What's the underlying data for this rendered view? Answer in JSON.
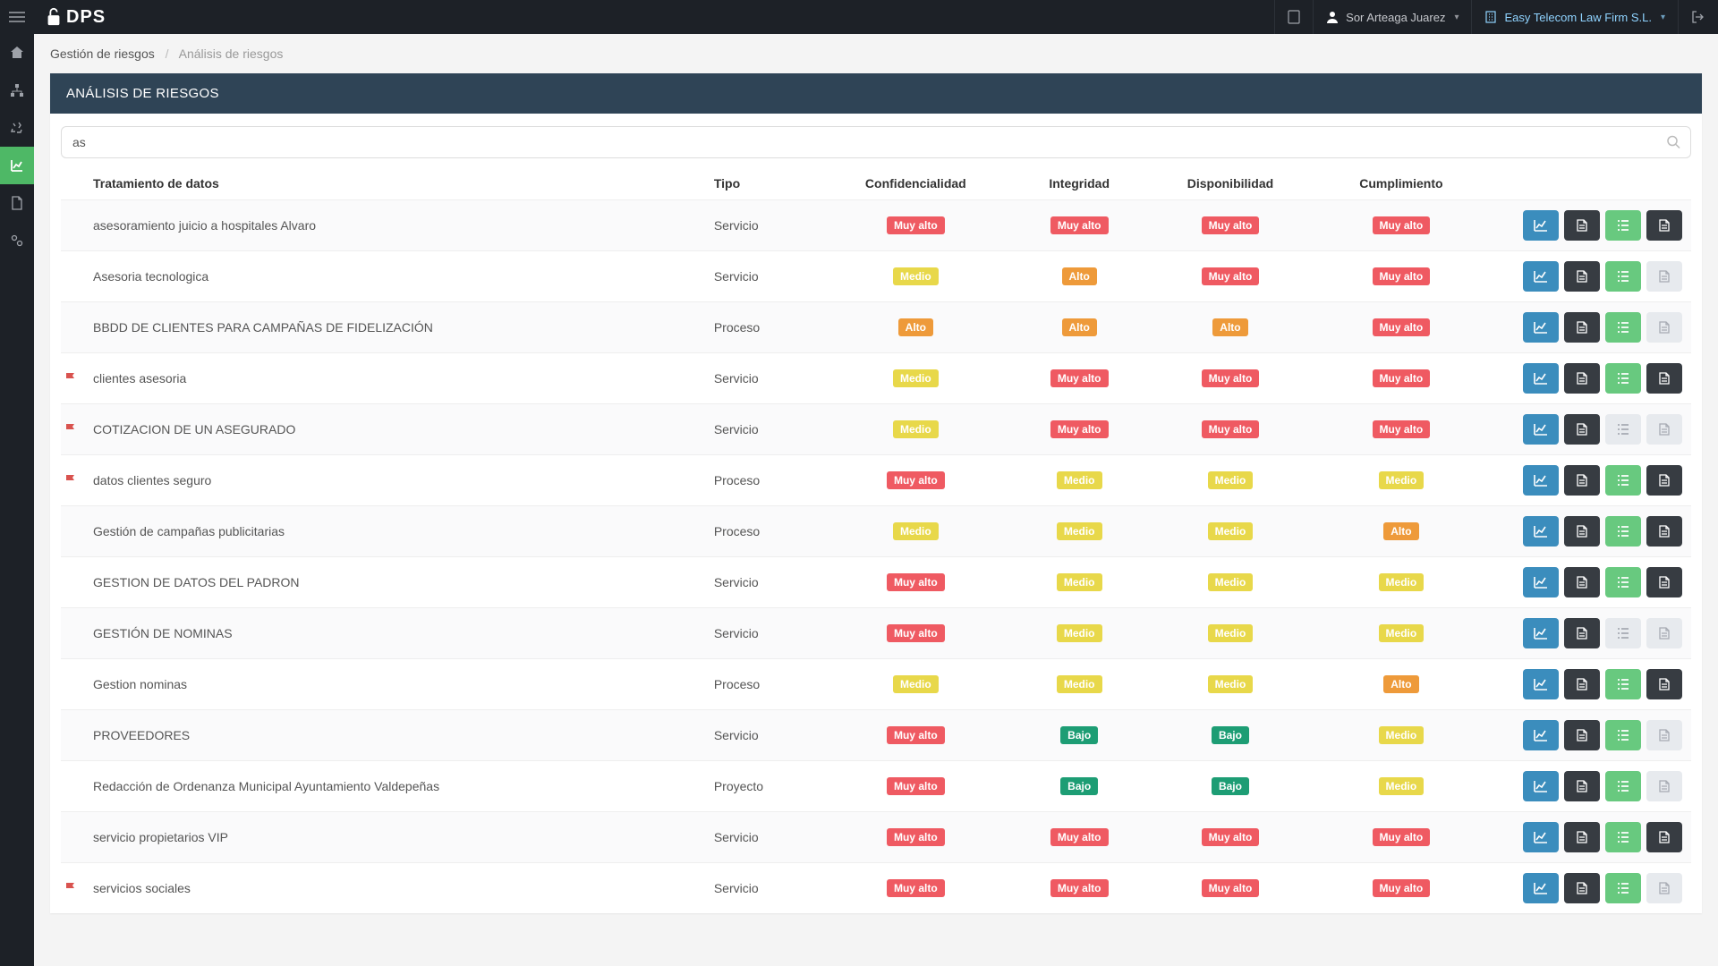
{
  "topbar": {
    "user_name": "Sor Arteaga Juarez",
    "org_name": "Easy Telecom Law Firm S.L."
  },
  "breadcrumbs": {
    "root": "Gestión de riesgos",
    "current": "Análisis de riesgos"
  },
  "panel": {
    "title": "ANÁLISIS DE RIESGOS"
  },
  "search": {
    "value": "as"
  },
  "columns": {
    "name": "Tratamiento de datos",
    "type": "Tipo",
    "conf": "Confidencialidad",
    "integ": "Integridad",
    "disp": "Disponibilidad",
    "cump": "Cumplimiento"
  },
  "levels": {
    "muy_alto": "Muy alto",
    "alto": "Alto",
    "medio": "Medio",
    "bajo": "Bajo"
  },
  "rows": [
    {
      "flag": false,
      "name": "asesoramiento juicio a hospitales Alvaro",
      "type": "Servicio",
      "conf": "muy_alto",
      "integ": "muy_alto",
      "disp": "muy_alto",
      "cump": "muy_alto",
      "b3": "green",
      "b4": "dark"
    },
    {
      "flag": false,
      "name": "Asesoria tecnologica",
      "type": "Servicio",
      "conf": "medio",
      "integ": "alto",
      "disp": "muy_alto",
      "cump": "muy_alto",
      "b3": "green",
      "b4": "disabled"
    },
    {
      "flag": false,
      "name": "BBDD DE CLIENTES PARA CAMPAÑAS DE FIDELIZACIÓN",
      "type": "Proceso",
      "conf": "alto",
      "integ": "alto",
      "disp": "alto",
      "cump": "muy_alto",
      "b3": "green",
      "b4": "disabled"
    },
    {
      "flag": true,
      "name": "clientes asesoria",
      "type": "Servicio",
      "conf": "medio",
      "integ": "muy_alto",
      "disp": "muy_alto",
      "cump": "muy_alto",
      "b3": "green",
      "b4": "dark"
    },
    {
      "flag": true,
      "name": "COTIZACION DE UN ASEGURADO",
      "type": "Servicio",
      "conf": "medio",
      "integ": "muy_alto",
      "disp": "muy_alto",
      "cump": "muy_alto",
      "b3": "disabled",
      "b4": "disabled"
    },
    {
      "flag": true,
      "name": "datos clientes seguro",
      "type": "Proceso",
      "conf": "muy_alto",
      "integ": "medio",
      "disp": "medio",
      "cump": "medio",
      "b3": "green",
      "b4": "dark"
    },
    {
      "flag": false,
      "name": "Gestión de campañas publicitarias",
      "type": "Proceso",
      "conf": "medio",
      "integ": "medio",
      "disp": "medio",
      "cump": "alto",
      "b3": "green",
      "b4": "dark"
    },
    {
      "flag": false,
      "name": "GESTION DE DATOS DEL PADRON",
      "type": "Servicio",
      "conf": "muy_alto",
      "integ": "medio",
      "disp": "medio",
      "cump": "medio",
      "b3": "green",
      "b4": "dark"
    },
    {
      "flag": false,
      "name": "GESTIÓN DE NOMINAS",
      "type": "Servicio",
      "conf": "muy_alto",
      "integ": "medio",
      "disp": "medio",
      "cump": "medio",
      "b3": "disabled",
      "b4": "disabled"
    },
    {
      "flag": false,
      "name": "Gestion nominas",
      "type": "Proceso",
      "conf": "medio",
      "integ": "medio",
      "disp": "medio",
      "cump": "alto",
      "b3": "green",
      "b4": "dark"
    },
    {
      "flag": false,
      "name": "PROVEEDORES",
      "type": "Servicio",
      "conf": "muy_alto",
      "integ": "bajo",
      "disp": "bajo",
      "cump": "medio",
      "b3": "green",
      "b4": "disabled"
    },
    {
      "flag": false,
      "name": "Redacción de Ordenanza Municipal Ayuntamiento Valdepeñas",
      "type": "Proyecto",
      "conf": "muy_alto",
      "integ": "bajo",
      "disp": "bajo",
      "cump": "medio",
      "b3": "green",
      "b4": "disabled"
    },
    {
      "flag": false,
      "name": "servicio propietarios VIP",
      "type": "Servicio",
      "conf": "muy_alto",
      "integ": "muy_alto",
      "disp": "muy_alto",
      "cump": "muy_alto",
      "b3": "green",
      "b4": "dark"
    },
    {
      "flag": true,
      "name": "servicios sociales",
      "type": "Servicio",
      "conf": "muy_alto",
      "integ": "muy_alto",
      "disp": "muy_alto",
      "cump": "muy_alto",
      "b3": "green",
      "b4": "disabled"
    }
  ]
}
